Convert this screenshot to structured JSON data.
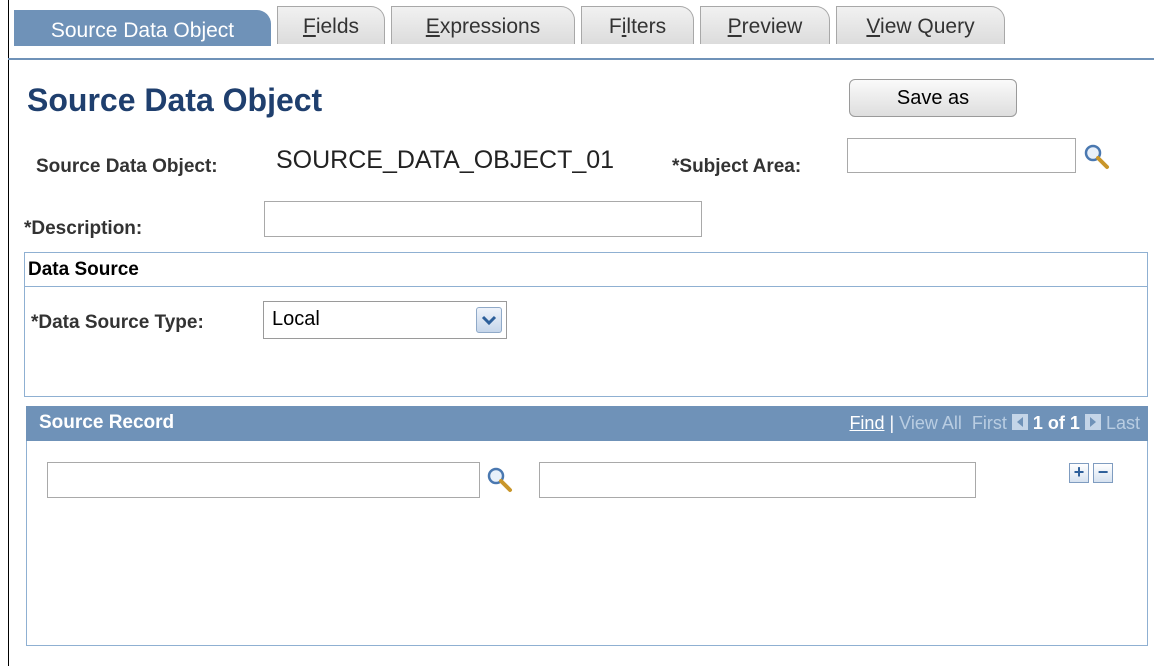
{
  "tabs": [
    {
      "label": "Source Data Object"
    },
    {
      "pre": "",
      "u": "F",
      "post": "ields"
    },
    {
      "pre": "",
      "u": "E",
      "post": "xpressions"
    },
    {
      "pre": "F",
      "u": "i",
      "post": "lters"
    },
    {
      "pre": "",
      "u": "P",
      "post": "review"
    },
    {
      "pre": "",
      "u": "V",
      "post": "iew Query"
    }
  ],
  "header": {
    "title": "Source Data Object",
    "save_label": "Save as"
  },
  "form": {
    "sdo_label": "Source Data Object:",
    "sdo_value": "SOURCE_DATA_OBJECT_01",
    "subject_label": "*Subject Area:",
    "subject_value": "",
    "description_label": "*Description:",
    "description_value": ""
  },
  "data_source": {
    "section_title": "Data Source",
    "type_label": "*Data Source Type:",
    "type_value": "Local"
  },
  "source_record": {
    "title": "Source Record",
    "find": "Find",
    "sep": "|",
    "view_all": "View All",
    "first": "First",
    "count": "1 of 1",
    "last": "Last",
    "record_value": "",
    "description_value": "",
    "add": "+",
    "remove": "−"
  },
  "icons": {
    "lookup": "magnifier-icon",
    "dropdown": "chevron-down-icon",
    "nav_prev": "triangle-left-icon",
    "nav_next": "triangle-right-icon"
  },
  "colors": {
    "accent": "#6f92b8",
    "title": "#1f3f6e",
    "section_border": "#8fb0d2"
  }
}
